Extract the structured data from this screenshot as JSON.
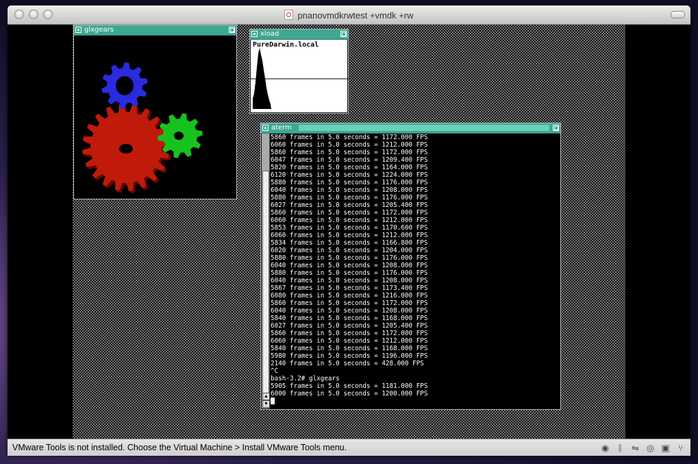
{
  "window": {
    "title": "pnanovmdkrwtest +vmdk +rw"
  },
  "windows": {
    "glxgears": {
      "title": "glxgears"
    },
    "xload": {
      "title": "xload",
      "hostname": "PureDarwin.local"
    },
    "aterm": {
      "title": "aterm",
      "lines": [
        "5860 frames in 5.0 seconds = 1172.000 FPS",
        "6060 frames in 5.0 seconds = 1212.000 FPS",
        "5860 frames in 5.0 seconds = 1172.000 FPS",
        "6047 frames in 5.0 seconds = 1209.400 FPS",
        "5820 frames in 5.0 seconds = 1164.000 FPS",
        "6120 frames in 5.0 seconds = 1224.000 FPS",
        "5880 frames in 5.0 seconds = 1176.000 FPS",
        "6040 frames in 5.0 seconds = 1208.000 FPS",
        "5880 frames in 5.0 seconds = 1176.000 FPS",
        "6027 frames in 5.0 seconds = 1205.400 FPS",
        "5860 frames in 5.0 seconds = 1172.000 FPS",
        "6060 frames in 5.0 seconds = 1212.000 FPS",
        "5853 frames in 5.0 seconds = 1170.600 FPS",
        "6060 frames in 5.0 seconds = 1212.000 FPS",
        "5834 frames in 5.0 seconds = 1166.800 FPS",
        "6020 frames in 5.0 seconds = 1204.000 FPS",
        "5880 frames in 5.0 seconds = 1176.000 FPS",
        "6040 frames in 5.0 seconds = 1208.000 FPS",
        "5880 frames in 5.0 seconds = 1176.000 FPS",
        "6040 frames in 5.0 seconds = 1208.000 FPS",
        "5867 frames in 5.0 seconds = 1173.400 FPS",
        "6080 frames in 5.0 seconds = 1216.000 FPS",
        "5860 frames in 5.0 seconds = 1172.000 FPS",
        "6040 frames in 5.0 seconds = 1208.000 FPS",
        "5840 frames in 5.0 seconds = 1168.000 FPS",
        "6027 frames in 5.0 seconds = 1205.400 FPS",
        "5860 frames in 5.0 seconds = 1172.000 FPS",
        "6060 frames in 5.0 seconds = 1212.000 FPS",
        "5840 frames in 5.0 seconds = 1168.000 FPS",
        "5980 frames in 5.0 seconds = 1196.000 FPS",
        "2140 frames in 5.0 seconds = 428.000 FPS",
        "^C",
        "bash-3.2# glxgears",
        "5905 frames in 5.0 seconds = 1181.000 FPS",
        "6000 frames in 5.0 seconds = 1200.000 FPS"
      ]
    }
  },
  "statusbar": {
    "message": "VMware Tools is not installed. Choose the Virtual Machine > Install VMware Tools menu.",
    "icons": [
      "webcam-icon",
      "bluetooth-icon",
      "network-icon",
      "cd-icon",
      "hard-disk-icon",
      "usb-icon"
    ]
  },
  "colors": {
    "titlebar_teal": "#3ea893",
    "gear_red": "#c01a0a",
    "gear_green": "#18c21e",
    "gear_blue": "#2a2ae0"
  }
}
